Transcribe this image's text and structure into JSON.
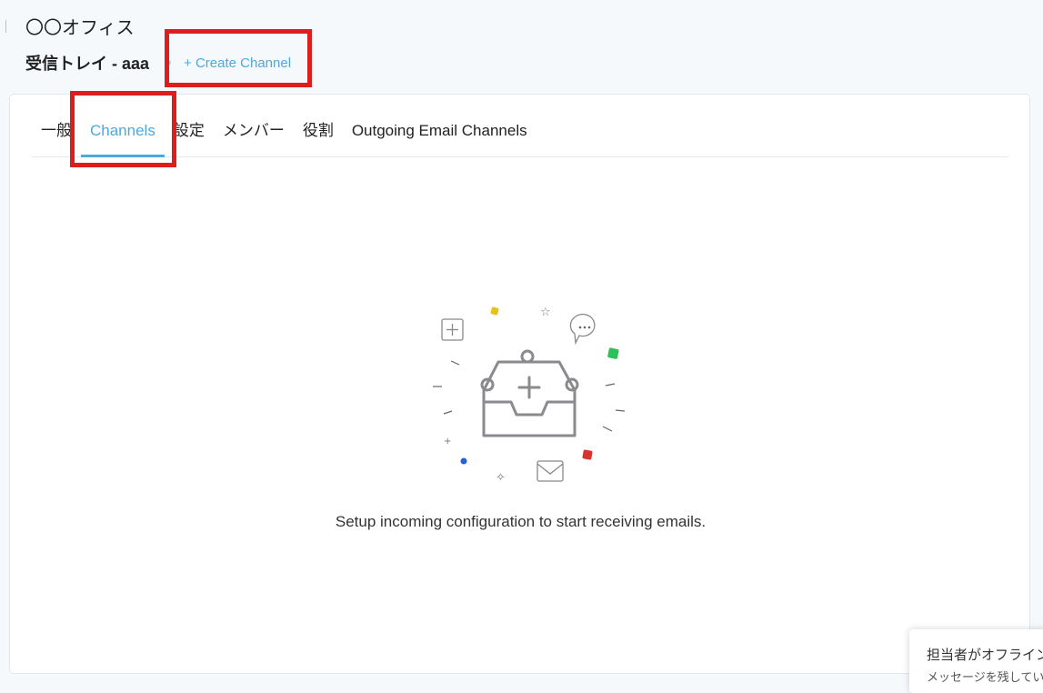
{
  "header": {
    "workspace_title": "〇〇オフィス",
    "inbox_title": "受信トレイ - aaa",
    "create_channel_label": "+ Create Channel"
  },
  "tabs": [
    {
      "label": "一般",
      "active": false
    },
    {
      "label": "Channels",
      "active": true
    },
    {
      "label": "設定",
      "active": false
    },
    {
      "label": "メンバー",
      "active": false
    },
    {
      "label": "役割",
      "active": false
    },
    {
      "label": "Outgoing Email Channels",
      "active": false
    }
  ],
  "empty_state": {
    "illustration_icon": "inbox-plus-icon",
    "message": "Setup incoming configuration to start receiving emails."
  },
  "chat_popup": {
    "title": "担当者がオフライン",
    "subtitle": "メッセージを残してい"
  },
  "colors": {
    "accent": "#4ea8de",
    "highlight": "#e11c1c",
    "page_bg": "#f5f9fc"
  }
}
